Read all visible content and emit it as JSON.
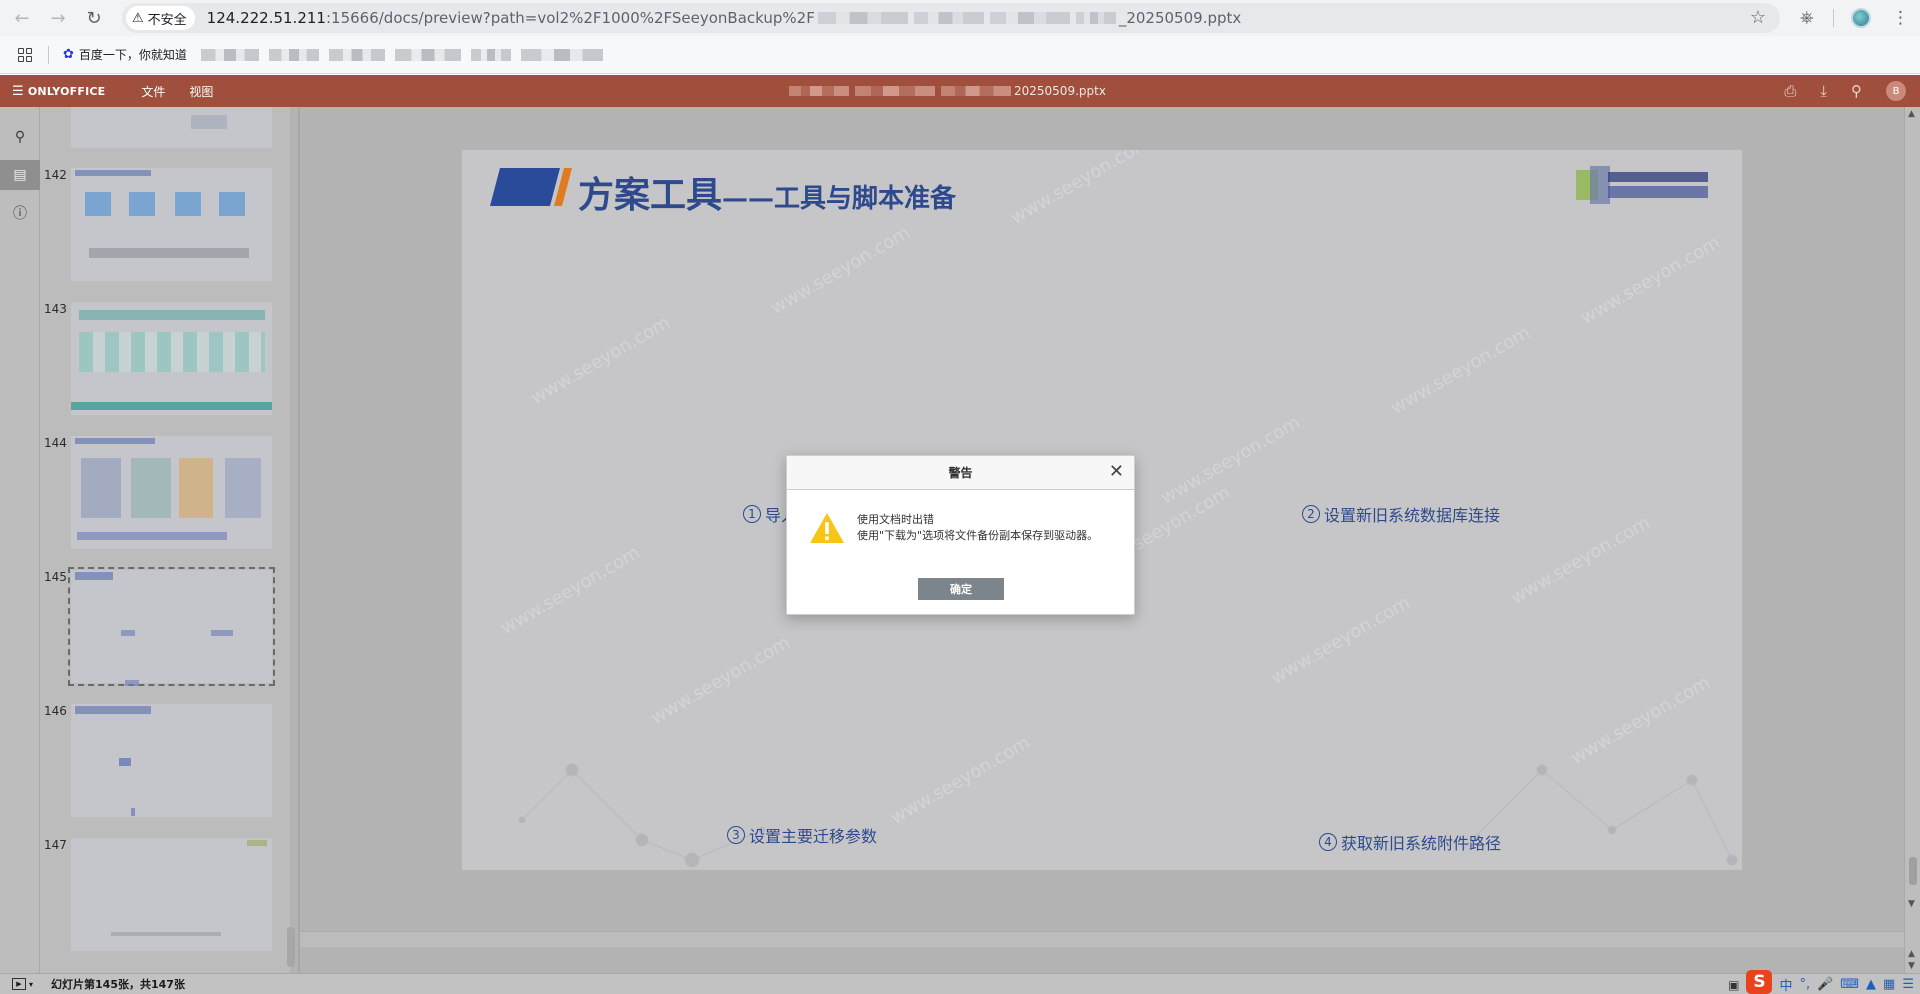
{
  "browser": {
    "security_label": "不安全",
    "url_host": "124.222.51.211",
    "url_path": ":15666/docs/preview?path=vol2%2F1000%2FSeeyonBackup%2F",
    "url_suffix": "_20250509.pptx"
  },
  "bookmarks": {
    "items": [
      {
        "label": "百度一下，你就知道",
        "icon": "baidu-paw-icon"
      }
    ]
  },
  "onlyoffice": {
    "brand": "ONLYOFFICE",
    "menu": [
      "文件",
      "视图"
    ],
    "doc_title_suffix": "20250509.pptx",
    "avatar_initial": "B"
  },
  "thumbnails": {
    "items": [
      {
        "number": "142"
      },
      {
        "number": "143"
      },
      {
        "number": "144"
      },
      {
        "number": "145",
        "selected": true
      },
      {
        "number": "146"
      },
      {
        "number": "147"
      }
    ]
  },
  "slide": {
    "title_main": "方案工具",
    "title_sub": "——工具与脚本准备",
    "steps": [
      {
        "num": "1",
        "label": "导入"
      },
      {
        "num": "2",
        "label": "设置新旧系统数据库连接"
      },
      {
        "num": "3",
        "label": "设置主要迁移参数"
      },
      {
        "num": "4",
        "label": "获取新旧系统附件路径"
      }
    ],
    "watermark": "www.seeyon.com"
  },
  "status": {
    "slide_info": "幻灯片第145张，共147张"
  },
  "tray": {
    "ime_label": "中"
  },
  "dialog": {
    "title": "警告",
    "message_line1": "使用文档时出错",
    "message_line2": "使用\"下载为\"选项将文件备份副本保存到驱动器。",
    "ok_label": "确定"
  },
  "colors": {
    "onlyoffice_header": "#9f4f3c",
    "slide_title": "#2e4a8c",
    "warning": "#f5c518",
    "ok_button": "#7d858c"
  }
}
